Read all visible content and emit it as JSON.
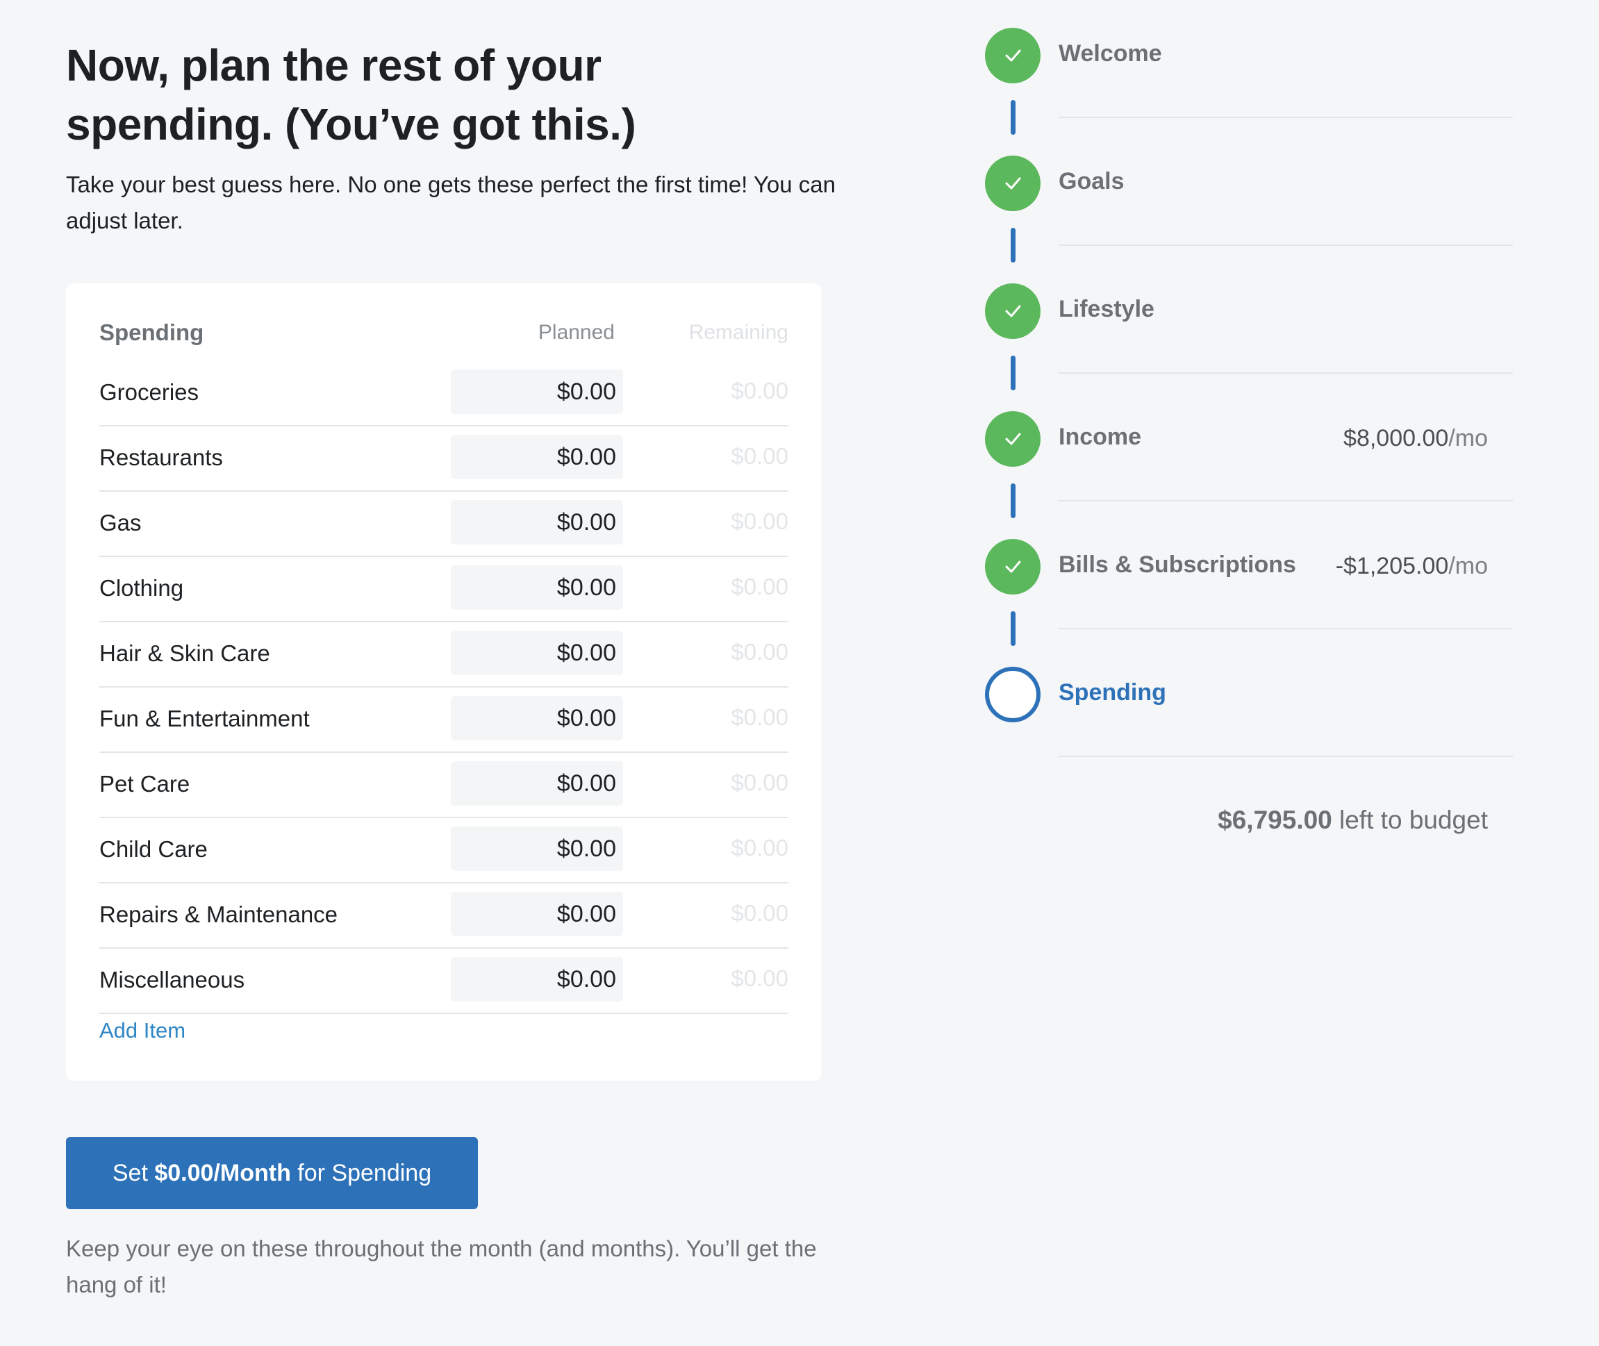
{
  "header": {
    "title": "Now, plan the rest of your spending. (You’ve got this.)",
    "intro": "Take your best guess here. No one gets these perfect the first time! You can adjust later."
  },
  "table": {
    "col_spending": "Spending",
    "col_planned": "Planned",
    "col_remaining": "Remaining",
    "rows": [
      {
        "label": "Groceries",
        "planned": "$0.00",
        "remaining": "$0.00"
      },
      {
        "label": "Restaurants",
        "planned": "$0.00",
        "remaining": "$0.00"
      },
      {
        "label": "Gas",
        "planned": "$0.00",
        "remaining": "$0.00"
      },
      {
        "label": "Clothing",
        "planned": "$0.00",
        "remaining": "$0.00"
      },
      {
        "label": "Hair & Skin Care",
        "planned": "$0.00",
        "remaining": "$0.00"
      },
      {
        "label": "Fun & Entertainment",
        "planned": "$0.00",
        "remaining": "$0.00"
      },
      {
        "label": "Pet Care",
        "planned": "$0.00",
        "remaining": "$0.00"
      },
      {
        "label": "Child Care",
        "planned": "$0.00",
        "remaining": "$0.00"
      },
      {
        "label": "Repairs & Maintenance",
        "planned": "$0.00",
        "remaining": "$0.00"
      },
      {
        "label": "Miscellaneous",
        "planned": "$0.00",
        "remaining": "$0.00"
      }
    ],
    "add_item": "Add Item"
  },
  "cta": {
    "prefix": "Set ",
    "amount": "$0.00/Month",
    "suffix": " for Spending"
  },
  "footnote": "Keep your eye on these throughout the month (and months). You’ll get the hang of it!",
  "steps": [
    {
      "label": "Welcome",
      "status": "complete",
      "amount": "",
      "unit": ""
    },
    {
      "label": "Goals",
      "status": "complete",
      "amount": "",
      "unit": ""
    },
    {
      "label": "Lifestyle",
      "status": "complete",
      "amount": "",
      "unit": ""
    },
    {
      "label": "Income",
      "status": "complete",
      "amount": "$8,000.00",
      "unit": "/mo"
    },
    {
      "label": "Bills & Subscriptions",
      "status": "complete",
      "amount": "-$1,205.00",
      "unit": "/mo"
    },
    {
      "label": "Spending",
      "status": "current",
      "amount": "",
      "unit": ""
    }
  ],
  "budget": {
    "amount": "$6,795.00",
    "text": " left to budget"
  },
  "colors": {
    "accent": "#2d72b8",
    "success": "#5cb85c",
    "link": "#2e86c7",
    "background": "#f5f6f8"
  }
}
